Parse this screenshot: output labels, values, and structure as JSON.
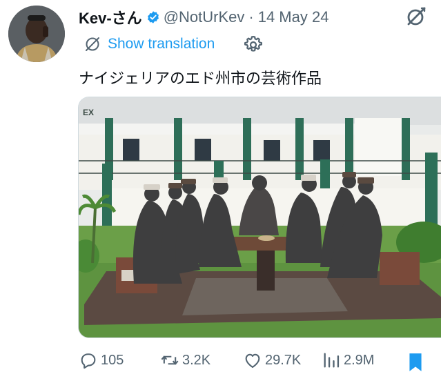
{
  "tweet": {
    "author_name": "Kev-さん",
    "handle": "@NotUrKev",
    "separator": "·",
    "date": "14 May 24",
    "translate_label": "Show translation",
    "text": "ナイジェリアのエド州市の芸術作品",
    "media": {
      "sign_text": "EX"
    }
  },
  "actions": {
    "replies": "105",
    "reposts": "3.2K",
    "likes": "29.7K",
    "views": "2.9M"
  },
  "icons": {
    "verified": "verified-badge-icon",
    "grok": "grok-icon",
    "translate": "translate-globe-icon",
    "settings": "gear-icon",
    "reply": "reply-icon",
    "repost": "repost-icon",
    "like": "heart-icon",
    "views": "views-icon",
    "bookmark": "bookmark-icon"
  },
  "colors": {
    "accent": "#1d9bf0",
    "muted": "#536471",
    "text": "#0f1419"
  }
}
